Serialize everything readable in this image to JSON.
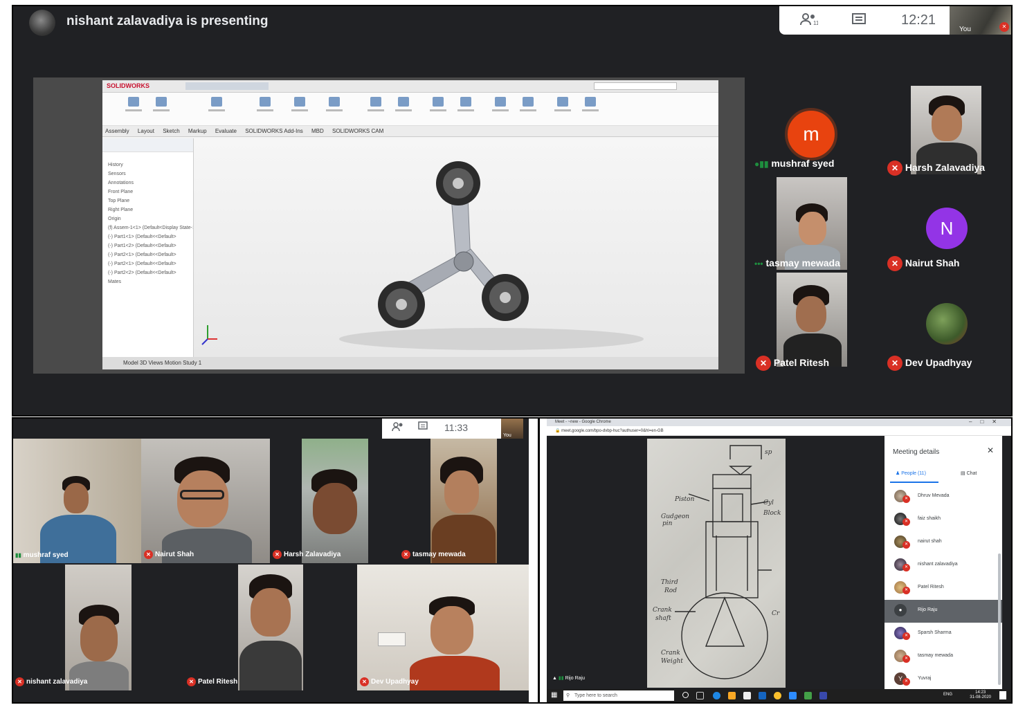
{
  "panel1": {
    "presenter_text": "nishant zalavadiya is presenting",
    "clock": "12:21",
    "self_label": "You",
    "share": {
      "app_logo": "SOLIDWORKS",
      "tabs": [
        "Assembly",
        "Layout",
        "Sketch",
        "Markup",
        "Evaluate",
        "SOLIDWORKS Add-Ins",
        "MBD",
        "SOLIDWORKS CAM"
      ],
      "tree_rows": [
        "History",
        "Sensors",
        "Annotations",
        "Front Plane",
        "Top Plane",
        "Right Plane",
        "Origin",
        "(f) Assem-1<1> (Default<Display State-1>)",
        "(-) Part1<1> (Default<<Default>",
        "(-) Part1<2> (Default<<Default>",
        "(-) Part2<1> (Default<<Default>",
        "(-) Part2<1> (Default<<Default>",
        "(-) Part2<2> (Default<<Default>",
        "Mates"
      ],
      "bottom_tabs": "Model   3D Views   Motion Study 1"
    },
    "participants": [
      {
        "name": "mushraf syed",
        "initial": "m",
        "color": "#e8430f",
        "status": "speaking"
      },
      {
        "name": "Harsh Zalavadiya",
        "status": "muted"
      },
      {
        "name": "tasmay mewada",
        "status": "speaking"
      },
      {
        "name": "Nairut Shah",
        "initial": "N",
        "color": "#9334e6",
        "status": "muted"
      },
      {
        "name": "Patel Ritesh",
        "status": "muted"
      },
      {
        "name": "Dev Upadhyay",
        "status": "muted"
      }
    ]
  },
  "panel2": {
    "clock": "11:33",
    "self_label": "You",
    "tiles": [
      "mushraf syed",
      "Nairut Shah",
      "Harsh Zalavadiya",
      "tasmay mewada",
      "nishant zalavadiya",
      "Patel Ritesh",
      "Dev Upadhyay"
    ]
  },
  "panel3": {
    "window_title": "Meet - ~new - Google Chrome",
    "url": "meet.google.com/bpo-dvbp-huc?authuser=0&hl=en-GB",
    "details_title": "Meeting details",
    "tab_people": "People (11)",
    "tab_chat": "Chat",
    "people": [
      "Dhruv Mevada",
      "faiz shaikh",
      "nairut shah",
      "nishant zalavadiya",
      "Patel Ritesh",
      "Rijo Raju",
      "Sparsh Sharma",
      "tasmay mewada",
      "Yuvraj"
    ],
    "self_name": "Rijo Raju",
    "taskbar": {
      "search_placeholder": "Type here to search",
      "time": "14:23",
      "date": "31-08-2020",
      "lang": "ENG"
    }
  },
  "colors": {
    "meet_dark": "#202124",
    "mute_red": "#d93025",
    "speaking_green": "#1e8e3e",
    "accent_blue": "#1a73e8"
  }
}
